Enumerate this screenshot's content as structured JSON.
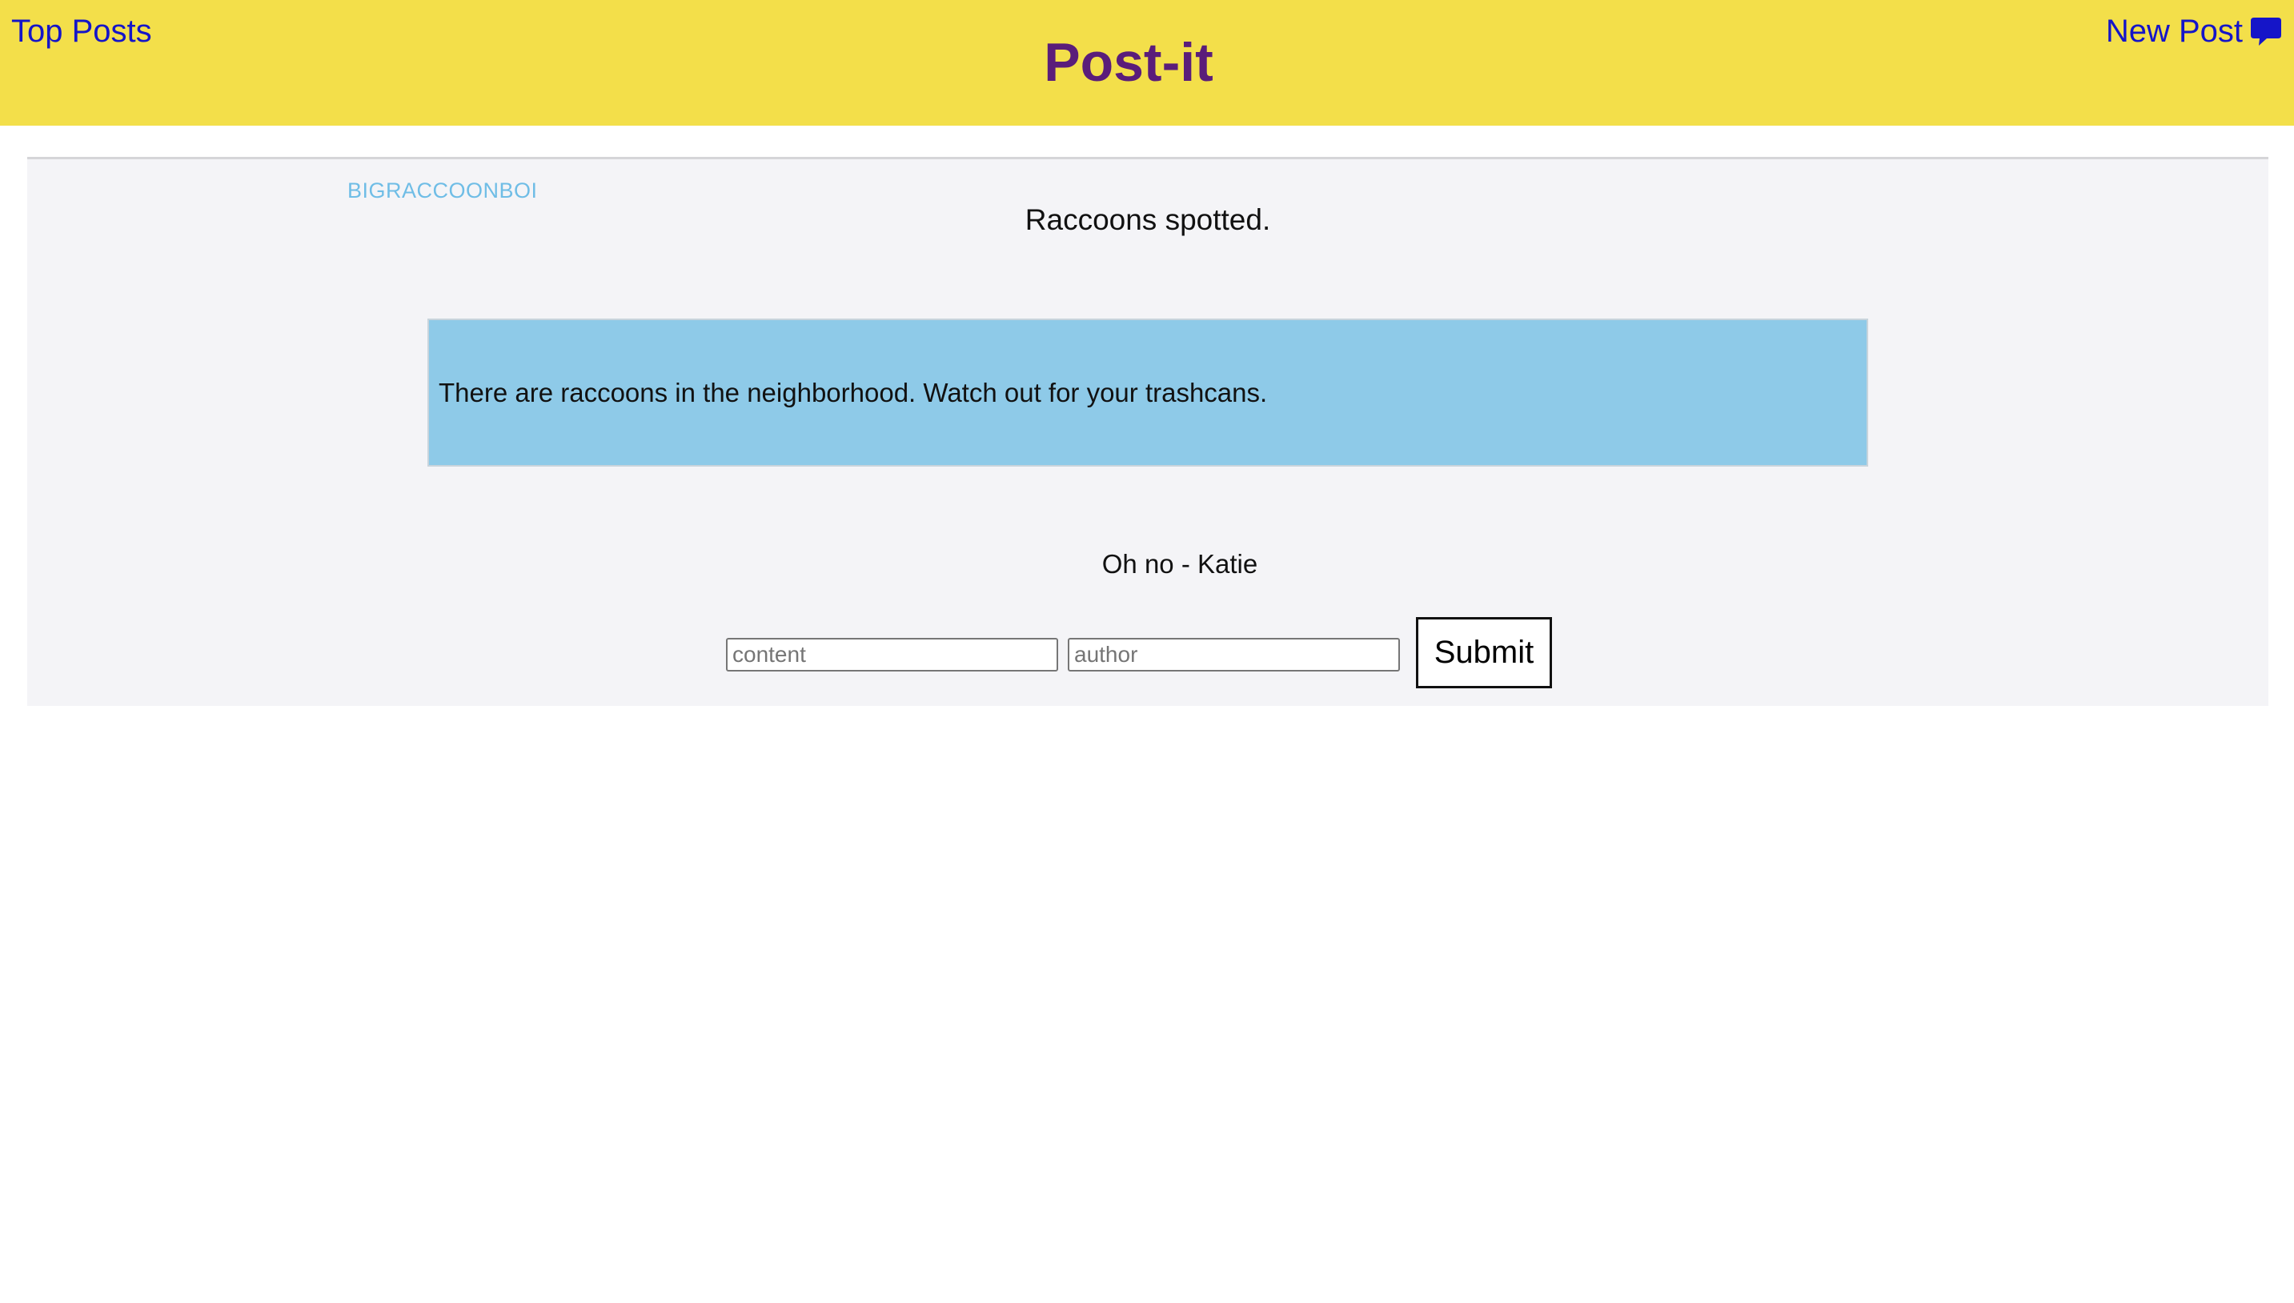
{
  "header": {
    "top_posts_label": "Top Posts",
    "site_title": "Post-it",
    "new_post_label": "New Post",
    "new_post_icon": "speech-bubble-icon",
    "background_color": "#f3df4a",
    "link_color": "#1515c8",
    "title_color": "#5a1d7a"
  },
  "post": {
    "author": "BIGRACCOONBOI",
    "title": "Raccoons spotted.",
    "body": "There are raccoons in the neighborhood. Watch out for your trashcans.",
    "body_background": "#8ecae8",
    "author_color": "#6fbde6"
  },
  "comments": [
    {
      "text": "Oh no - Katie"
    }
  ],
  "comment_form": {
    "content_placeholder": "content",
    "author_placeholder": "author",
    "submit_label": "Submit"
  }
}
